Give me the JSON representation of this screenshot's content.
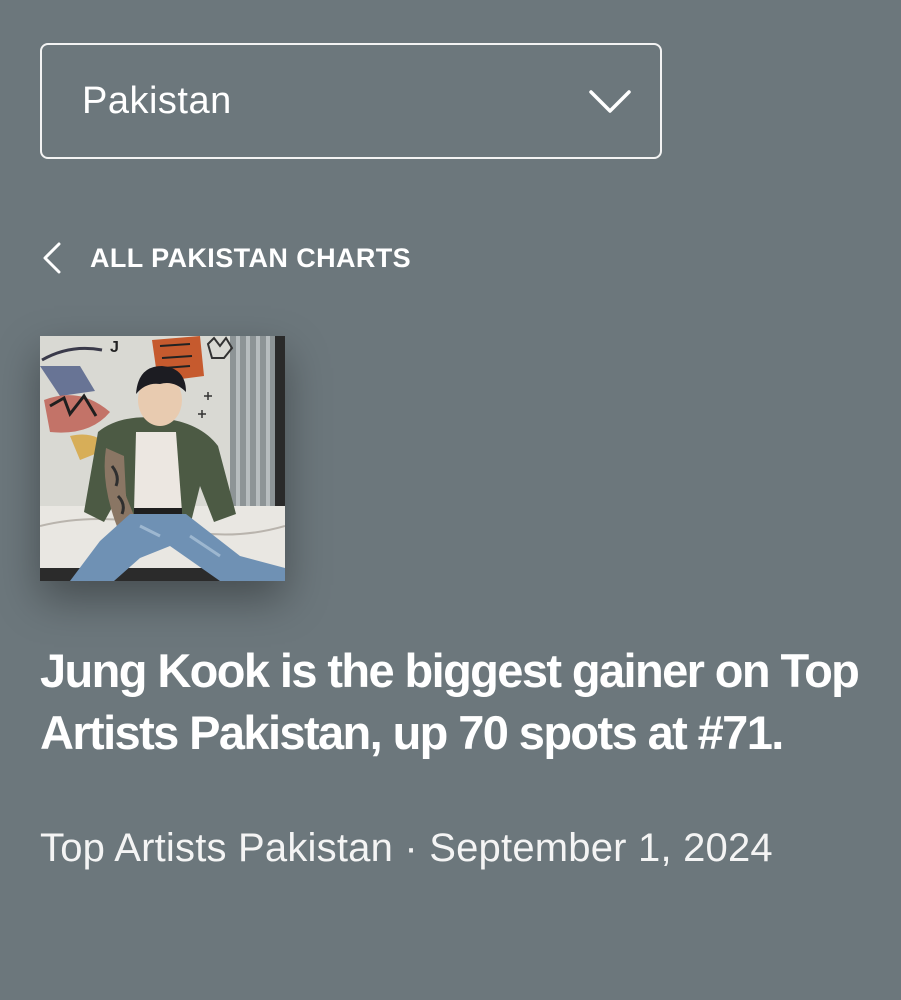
{
  "country_select": {
    "value": "Pakistan",
    "icon": "chevron-down-icon"
  },
  "breadcrumb": {
    "label": "ALL PAKISTAN CHARTS",
    "icon": "chevron-left-icon"
  },
  "headline": "Jung Kook is the biggest gainer on Top Artists Pakistan, up 70 spots at #71.",
  "meta": {
    "chart_name": "Top Artists Pakistan",
    "separator": "·",
    "date": "September 1, 2024"
  },
  "colors": {
    "background": "#6c777c",
    "text": "#ffffff"
  }
}
